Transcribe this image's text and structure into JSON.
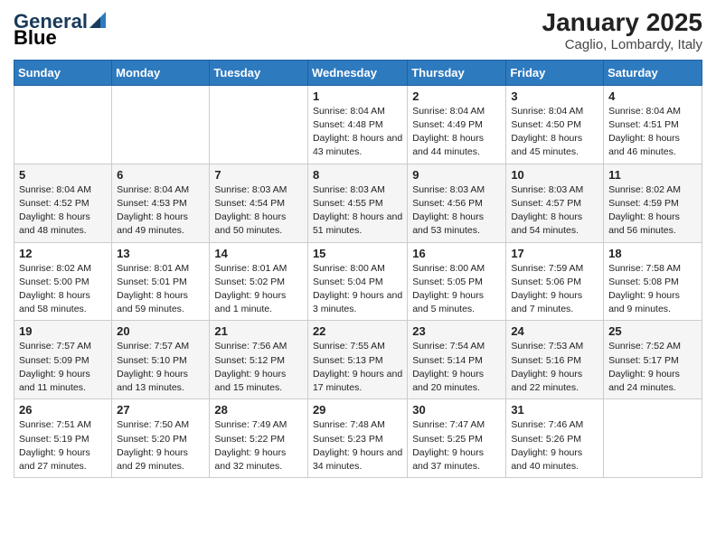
{
  "header": {
    "logo_general": "General",
    "logo_blue": "Blue",
    "month_year": "January 2025",
    "location": "Caglio, Lombardy, Italy"
  },
  "days_of_week": [
    "Sunday",
    "Monday",
    "Tuesday",
    "Wednesday",
    "Thursday",
    "Friday",
    "Saturday"
  ],
  "weeks": [
    [
      {
        "day": "",
        "info": ""
      },
      {
        "day": "",
        "info": ""
      },
      {
        "day": "",
        "info": ""
      },
      {
        "day": "1",
        "info": "Sunrise: 8:04 AM\nSunset: 4:48 PM\nDaylight: 8 hours and 43 minutes."
      },
      {
        "day": "2",
        "info": "Sunrise: 8:04 AM\nSunset: 4:49 PM\nDaylight: 8 hours and 44 minutes."
      },
      {
        "day": "3",
        "info": "Sunrise: 8:04 AM\nSunset: 4:50 PM\nDaylight: 8 hours and 45 minutes."
      },
      {
        "day": "4",
        "info": "Sunrise: 8:04 AM\nSunset: 4:51 PM\nDaylight: 8 hours and 46 minutes."
      }
    ],
    [
      {
        "day": "5",
        "info": "Sunrise: 8:04 AM\nSunset: 4:52 PM\nDaylight: 8 hours and 48 minutes."
      },
      {
        "day": "6",
        "info": "Sunrise: 8:04 AM\nSunset: 4:53 PM\nDaylight: 8 hours and 49 minutes."
      },
      {
        "day": "7",
        "info": "Sunrise: 8:03 AM\nSunset: 4:54 PM\nDaylight: 8 hours and 50 minutes."
      },
      {
        "day": "8",
        "info": "Sunrise: 8:03 AM\nSunset: 4:55 PM\nDaylight: 8 hours and 51 minutes."
      },
      {
        "day": "9",
        "info": "Sunrise: 8:03 AM\nSunset: 4:56 PM\nDaylight: 8 hours and 53 minutes."
      },
      {
        "day": "10",
        "info": "Sunrise: 8:03 AM\nSunset: 4:57 PM\nDaylight: 8 hours and 54 minutes."
      },
      {
        "day": "11",
        "info": "Sunrise: 8:02 AM\nSunset: 4:59 PM\nDaylight: 8 hours and 56 minutes."
      }
    ],
    [
      {
        "day": "12",
        "info": "Sunrise: 8:02 AM\nSunset: 5:00 PM\nDaylight: 8 hours and 58 minutes."
      },
      {
        "day": "13",
        "info": "Sunrise: 8:01 AM\nSunset: 5:01 PM\nDaylight: 8 hours and 59 minutes."
      },
      {
        "day": "14",
        "info": "Sunrise: 8:01 AM\nSunset: 5:02 PM\nDaylight: 9 hours and 1 minute."
      },
      {
        "day": "15",
        "info": "Sunrise: 8:00 AM\nSunset: 5:04 PM\nDaylight: 9 hours and 3 minutes."
      },
      {
        "day": "16",
        "info": "Sunrise: 8:00 AM\nSunset: 5:05 PM\nDaylight: 9 hours and 5 minutes."
      },
      {
        "day": "17",
        "info": "Sunrise: 7:59 AM\nSunset: 5:06 PM\nDaylight: 9 hours and 7 minutes."
      },
      {
        "day": "18",
        "info": "Sunrise: 7:58 AM\nSunset: 5:08 PM\nDaylight: 9 hours and 9 minutes."
      }
    ],
    [
      {
        "day": "19",
        "info": "Sunrise: 7:57 AM\nSunset: 5:09 PM\nDaylight: 9 hours and 11 minutes."
      },
      {
        "day": "20",
        "info": "Sunrise: 7:57 AM\nSunset: 5:10 PM\nDaylight: 9 hours and 13 minutes."
      },
      {
        "day": "21",
        "info": "Sunrise: 7:56 AM\nSunset: 5:12 PM\nDaylight: 9 hours and 15 minutes."
      },
      {
        "day": "22",
        "info": "Sunrise: 7:55 AM\nSunset: 5:13 PM\nDaylight: 9 hours and 17 minutes."
      },
      {
        "day": "23",
        "info": "Sunrise: 7:54 AM\nSunset: 5:14 PM\nDaylight: 9 hours and 20 minutes."
      },
      {
        "day": "24",
        "info": "Sunrise: 7:53 AM\nSunset: 5:16 PM\nDaylight: 9 hours and 22 minutes."
      },
      {
        "day": "25",
        "info": "Sunrise: 7:52 AM\nSunset: 5:17 PM\nDaylight: 9 hours and 24 minutes."
      }
    ],
    [
      {
        "day": "26",
        "info": "Sunrise: 7:51 AM\nSunset: 5:19 PM\nDaylight: 9 hours and 27 minutes."
      },
      {
        "day": "27",
        "info": "Sunrise: 7:50 AM\nSunset: 5:20 PM\nDaylight: 9 hours and 29 minutes."
      },
      {
        "day": "28",
        "info": "Sunrise: 7:49 AM\nSunset: 5:22 PM\nDaylight: 9 hours and 32 minutes."
      },
      {
        "day": "29",
        "info": "Sunrise: 7:48 AM\nSunset: 5:23 PM\nDaylight: 9 hours and 34 minutes."
      },
      {
        "day": "30",
        "info": "Sunrise: 7:47 AM\nSunset: 5:25 PM\nDaylight: 9 hours and 37 minutes."
      },
      {
        "day": "31",
        "info": "Sunrise: 7:46 AM\nSunset: 5:26 PM\nDaylight: 9 hours and 40 minutes."
      },
      {
        "day": "",
        "info": ""
      }
    ]
  ]
}
